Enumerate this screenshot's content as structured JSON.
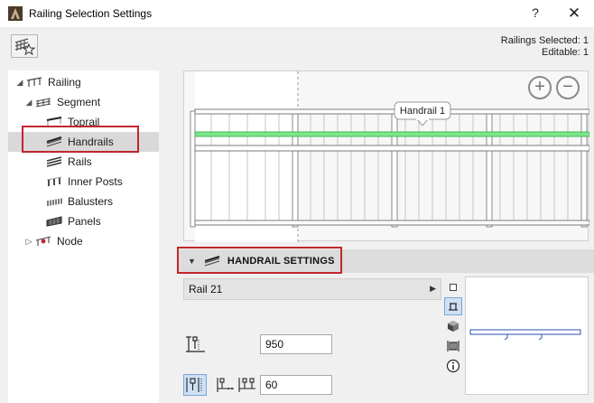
{
  "window": {
    "title": "Railing Selection Settings",
    "help_label": "?",
    "close_label": "✕"
  },
  "selection": {
    "selected_line": "Railings Selected: 1",
    "editable_line": "Editable: 1"
  },
  "tree": {
    "items": [
      {
        "label": "Railing",
        "arrow": "◢",
        "icon": "railing-icon"
      },
      {
        "label": "Segment",
        "arrow": "◢",
        "icon": "segment-icon"
      },
      {
        "label": "Toprail",
        "arrow": "",
        "icon": "toprail-icon"
      },
      {
        "label": "Handrails",
        "arrow": "",
        "icon": "handrails-icon",
        "selected": true
      },
      {
        "label": "Rails",
        "arrow": "",
        "icon": "rails-icon"
      },
      {
        "label": "Inner Posts",
        "arrow": "",
        "icon": "inner-posts-icon"
      },
      {
        "label": "Balusters",
        "arrow": "",
        "icon": "balusters-icon"
      },
      {
        "label": "Panels",
        "arrow": "",
        "icon": "panels-icon"
      },
      {
        "label": "Node",
        "arrow": "▷",
        "icon": "node-icon"
      }
    ]
  },
  "preview": {
    "tooltip": "Handrail 1",
    "zoom_in_label": "+",
    "zoom_out_label": "−",
    "highlight_color": "#7ee68a"
  },
  "handrail_settings": {
    "title": "HANDRAIL SETTINGS",
    "profile": "Rail 21",
    "height_value": "950",
    "offset_value": "60"
  },
  "colors": {
    "highlight_box": "#c1272d",
    "section_header": "#dcdcdc",
    "tool_active": "#cfe0f5"
  }
}
